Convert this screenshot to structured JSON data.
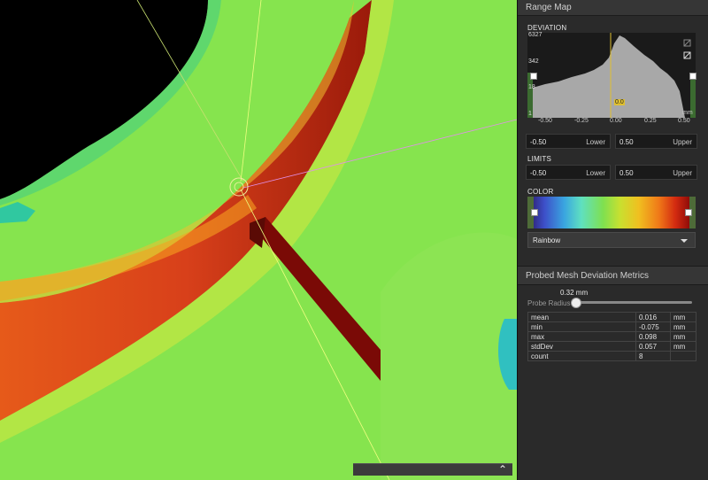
{
  "range_map": {
    "title": "Range Map",
    "deviation_label": "DEVIATION",
    "y_ticks": [
      "6327",
      "342",
      "18",
      "1"
    ],
    "x_ticks": [
      "-0.50",
      "-0.25",
      "0.00",
      "0.25",
      "0.50"
    ],
    "x_unit": "mm",
    "marker_value": "0.0",
    "range_fields": [
      {
        "value": "-0.50",
        "unit": "Lower"
      },
      {
        "value": "0.50",
        "unit": "Upper"
      }
    ],
    "limits_label": "LIMITS",
    "limit_fields": [
      {
        "value": "-0.50",
        "unit": "Lower"
      },
      {
        "value": "0.50",
        "unit": "Upper"
      }
    ],
    "color_label": "COLOR",
    "colormap": "Rainbow"
  },
  "metrics": {
    "title": "Probed Mesh Deviation Metrics",
    "probe_value": "0.32 mm",
    "probe_label": "Probe Radius",
    "rows": [
      {
        "name": "mean",
        "value": "0.016",
        "unit": "mm"
      },
      {
        "name": "min",
        "value": "-0.075",
        "unit": "mm"
      },
      {
        "name": "max",
        "value": "0.098",
        "unit": "mm"
      },
      {
        "name": "stdDev",
        "value": "0.057",
        "unit": "mm"
      },
      {
        "name": "count",
        "value": "8",
        "unit": ""
      }
    ]
  },
  "icons": [
    "collapse-up-icon",
    "hide-icon",
    "crop-icon"
  ]
}
